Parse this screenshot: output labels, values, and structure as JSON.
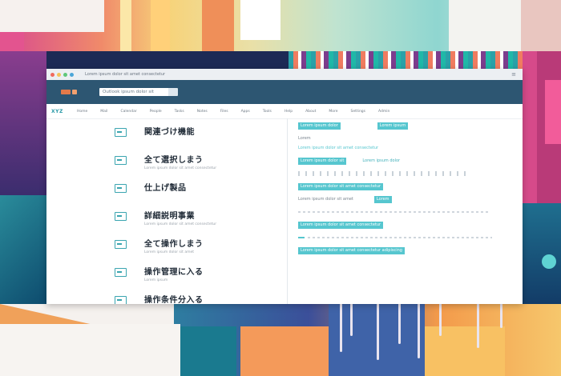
{
  "window": {
    "title": "Lorem ipsum dolor sit amet consectetur",
    "controls_label": "≡",
    "address": "Outlook ipsum dolor sit",
    "brand": "XYZ"
  },
  "nav": [
    "Home",
    "Mail",
    "Calendar",
    "People",
    "Tasks",
    "Notes",
    "Files",
    "Apps",
    "Tools",
    "Help",
    "About",
    "More",
    "Settings",
    "Admin"
  ],
  "list_items": [
    {
      "title": "関連づけ機能",
      "sub": ""
    },
    {
      "title": "全て選択しまう",
      "sub": "Lorem ipsum dolor sit amet consectetur"
    },
    {
      "title": "仕上げ製品",
      "sub": ""
    },
    {
      "title": "詳細説明事業",
      "sub": "Lorem ipsum dolor sit amet consectetur"
    },
    {
      "title": "全て操作しまう",
      "sub": "Lorem ipsum dolor sit amet"
    },
    {
      "title": "操作管理に入る",
      "sub": "Lorem ipsum"
    },
    {
      "title": "操作条件分入る",
      "sub": ""
    }
  ],
  "right_panel": {
    "row1_tag": "Lorem ipsum dolor",
    "row1_tag2": "Lorem ipsum",
    "row2_left": "Lorem",
    "row2_teal": "Lorem ipsum dolor sit amet consectetur",
    "row3_tag": "Lorem ipsum dolor sit",
    "row3_teal": "Lorem ipsum dolor",
    "row4_tag": "Lorem ipsum dolor sit amet consectetur",
    "row5_gray": "Lorem ipsum dolor sit amet",
    "row5_tag": "Lorem",
    "row6_tag": "Lorem ipsum dolor sit amet consectetur",
    "row7_tag": "Lorem ipsum dolor sit amet consectetur adipiscing"
  },
  "colors": {
    "accent": "#56c6cf",
    "header": "#2d5672",
    "dot_red": "#f06a5e",
    "dot_yellow": "#f5c35a",
    "dot_green": "#5fc77a"
  }
}
